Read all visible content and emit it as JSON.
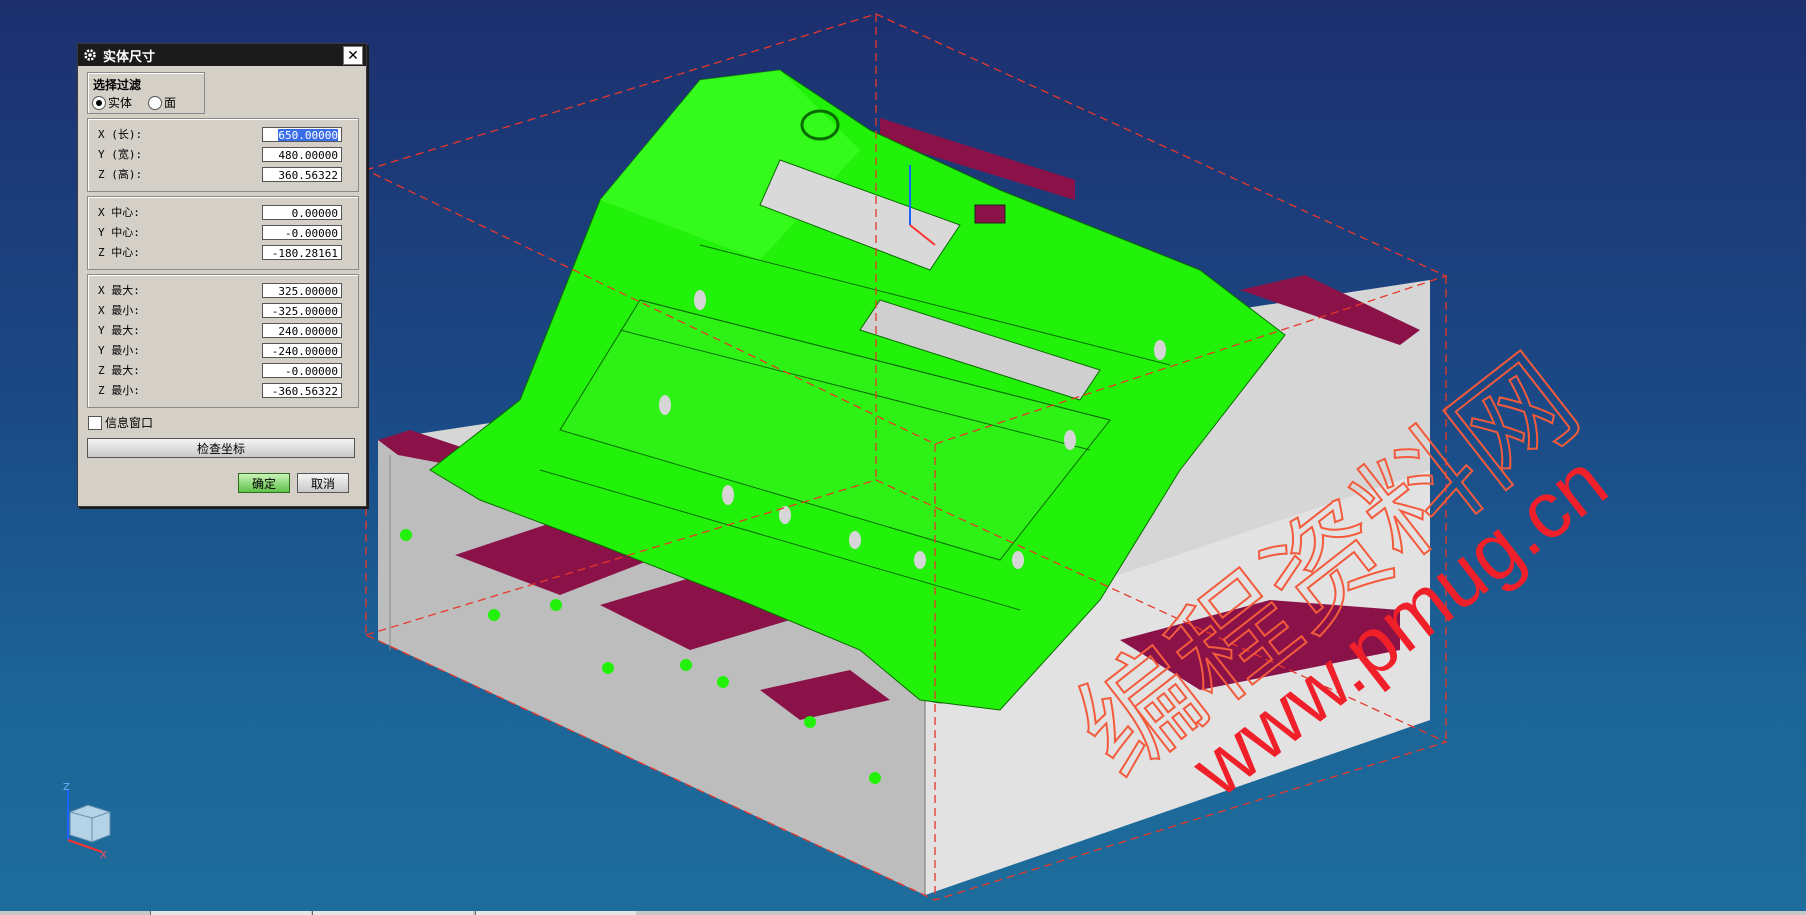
{
  "dialog": {
    "title": "实体尺寸",
    "filter": {
      "title": "选择过滤",
      "options": [
        {
          "label": "实体",
          "selected": true
        },
        {
          "label": "面",
          "selected": false
        }
      ]
    },
    "size": [
      {
        "label": "X (长):",
        "value": "650.00000"
      },
      {
        "label": "Y (宽):",
        "value": "480.00000"
      },
      {
        "label": "Z (高):",
        "value": "360.56322"
      }
    ],
    "center": [
      {
        "label": "X 中心:",
        "value": "0.00000"
      },
      {
        "label": "Y 中心:",
        "value": "-0.00000"
      },
      {
        "label": "Z 中心:",
        "value": "-180.28161"
      }
    ],
    "extents": [
      {
        "label": "X 最大:",
        "value": "325.00000"
      },
      {
        "label": "X 最小:",
        "value": "-325.00000"
      },
      {
        "label": "Y 最大:",
        "value": "240.00000"
      },
      {
        "label": "Y 最小:",
        "value": "-240.00000"
      },
      {
        "label": "Z 最大:",
        "value": "-0.00000"
      },
      {
        "label": "Z 最小:",
        "value": "-360.56322"
      }
    ],
    "info_window_label": "信息窗口",
    "check_coords_label": "检查坐标",
    "ok_label": "确定",
    "cancel_label": "取消"
  },
  "viewport": {
    "watermark_cn": "编程资料网",
    "watermark_url": "www.pmug.cn",
    "triad": {
      "z": "Z",
      "x": "X"
    },
    "colors": {
      "part_green": "#22f20a",
      "base_gray": "#d9d9d9",
      "pocket_maroon": "#8a1248",
      "bbox_red": "#e8372a",
      "watermark": "#f35b3c"
    }
  }
}
